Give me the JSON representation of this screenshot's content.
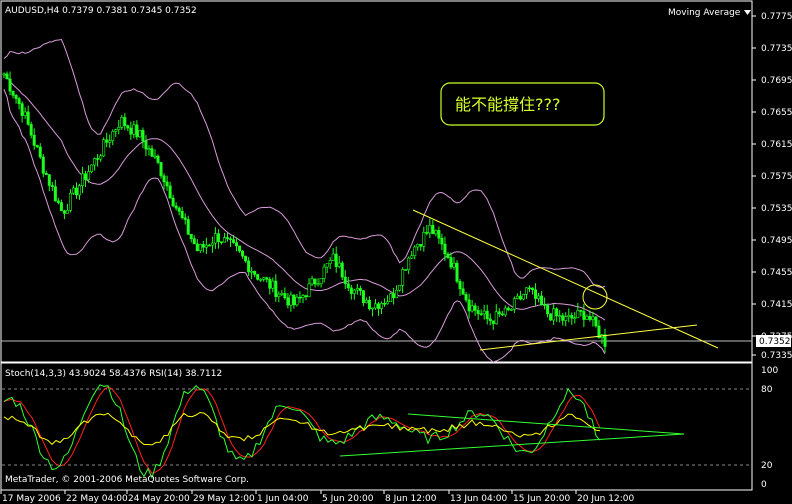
{
  "main_chart": {
    "symbol_header": "AUDUSD,H4  0.7379 0.7381 0.7345 0.7352",
    "indicator_name": "Moving Average",
    "annotation": "能不能撐住???",
    "current_price_label": "0.7352",
    "price_axis_labels": [
      "0.7775",
      "0.7735",
      "0.7695",
      "0.7655",
      "0.7615",
      "0.7575",
      "0.7535",
      "0.7495",
      "0.7455",
      "0.7415",
      "0.7375",
      "0.7335"
    ]
  },
  "sub_chart": {
    "header": "Stoch(14,3,3) 43.9024 58.4376  RSI(14) 38.7112",
    "watermark": "MetaTrader, © 2001-2006 MetaQuotes Software Corp.",
    "axis_labels": [
      "100",
      "80",
      "20",
      "0"
    ]
  },
  "time_axis": [
    "17 May 2006",
    "22 May 04:00",
    "24 May 20:00",
    "29 May 12:00",
    "1 Jun 04:00",
    "5 Jun 20:00",
    "8 Jun 12:00",
    "13 Jun 04:00",
    "15 Jun 20:00",
    "20 Jun 12:00"
  ],
  "colors": {
    "candles": "#1eff1e",
    "bollinger": "#d79bd7",
    "trendlines": "#ffff44",
    "stoch_main": "#32ff32",
    "stoch_signal": "#ff2020",
    "rsi": "#ffff00",
    "annotation_box": "#c8ff28",
    "axis": "#ffffff"
  },
  "chart_data": [
    {
      "type": "line",
      "title": "AUDUSD,H4",
      "series": [
        {
          "name": "Moving Average",
          "values": []
        }
      ],
      "ylim": [
        0.7335,
        0.7775
      ],
      "x": [
        "17 May 2006",
        "22 May 04:00",
        "24 May 20:00",
        "29 May 12:00",
        "1 Jun 04:00",
        "5 Jun 20:00",
        "8 Jun 12:00",
        "13 Jun 04:00",
        "15 Jun 20:00",
        "20 Jun 12:00"
      ],
      "close_path_estimate": [
        0.77,
        0.765,
        0.758,
        0.752,
        0.756,
        0.76,
        0.764,
        0.762,
        0.758,
        0.752,
        0.747,
        0.749,
        0.747,
        0.744,
        0.742,
        0.74,
        0.743,
        0.746,
        0.742,
        0.74,
        0.741,
        0.747,
        0.75,
        0.746,
        0.74,
        0.738,
        0.739,
        0.742,
        0.739,
        0.738,
        0.739,
        0.7352
      ]
    },
    {
      "type": "line",
      "title": "Stoch(14,3,3) RSI(14)",
      "series": [
        {
          "name": "Stoch main",
          "values": []
        },
        {
          "name": "Stoch signal",
          "values": []
        },
        {
          "name": "RSI(14)",
          "values": []
        }
      ],
      "ylim": [
        0,
        100
      ],
      "grid_levels": [
        20,
        80
      ],
      "last_values": {
        "stoch_main": 43.9024,
        "stoch_signal": 58.4376,
        "rsi": 38.7112
      }
    }
  ]
}
